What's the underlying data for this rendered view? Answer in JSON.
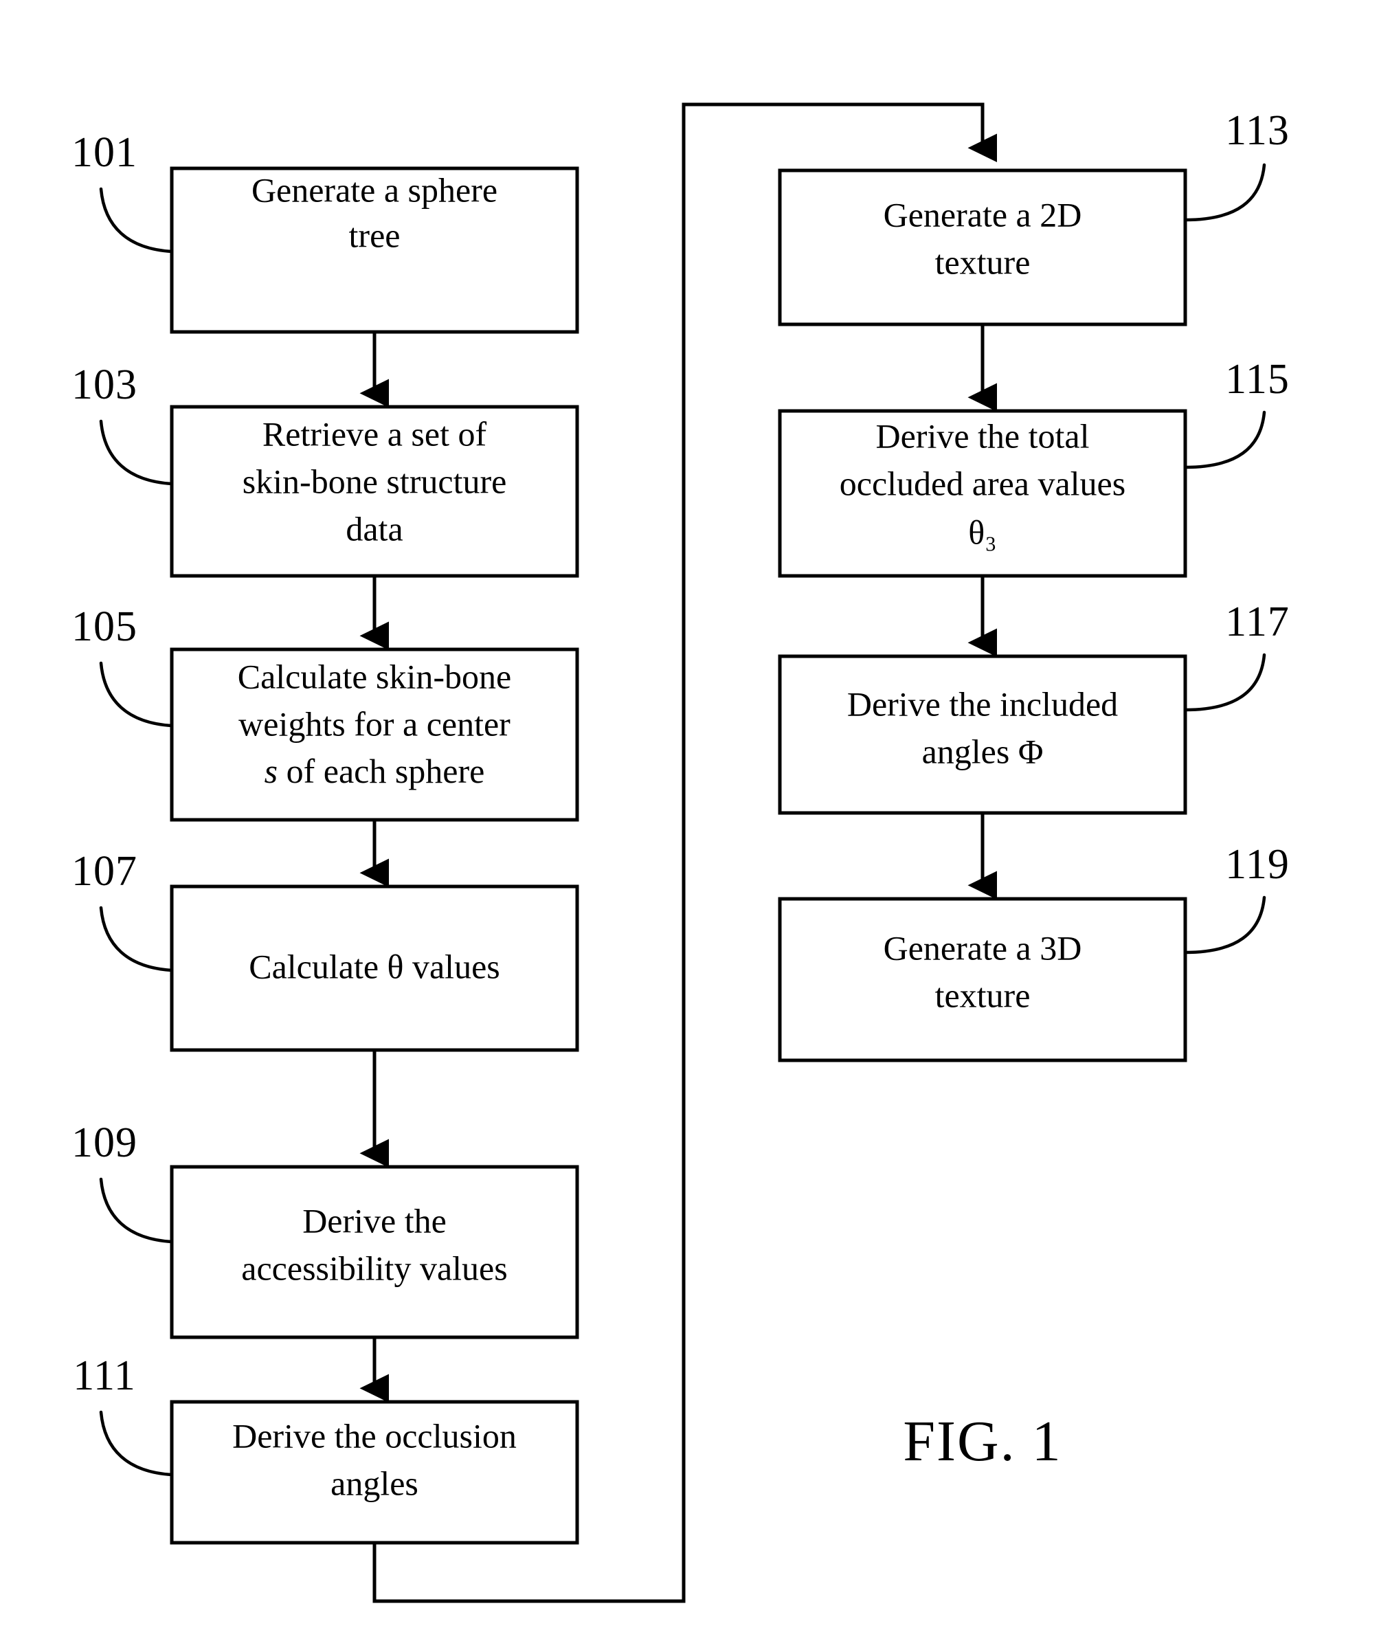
{
  "figure": {
    "caption": "FIG. 1",
    "background_color": "#ffffff",
    "line_color": "#000000"
  },
  "boxes": [
    {
      "ref": "101",
      "lines": [
        "Generate a sphere",
        "tree"
      ],
      "column": "left"
    },
    {
      "ref": "103",
      "lines": [
        "Retrieve a set of",
        "skin-bone structure",
        "data"
      ],
      "column": "left"
    },
    {
      "ref": "105",
      "lines": [
        "Calculate skin-bone",
        "weights for a center",
        "s of each sphere"
      ],
      "italic_token": "s",
      "column": "left"
    },
    {
      "ref": "107",
      "lines": [
        "Calculate θ values"
      ],
      "column": "left"
    },
    {
      "ref": "109",
      "lines": [
        "Derive the",
        "accessibility values"
      ],
      "column": "left"
    },
    {
      "ref": "111",
      "lines": [
        "Derive the occlusion",
        "angles"
      ],
      "column": "left"
    },
    {
      "ref": "113",
      "lines": [
        "Generate a 2D",
        "texture"
      ],
      "column": "right"
    },
    {
      "ref": "115",
      "lines": [
        "Derive the total",
        "occluded area values",
        "θ₃"
      ],
      "subscript_line": "θ₃",
      "column": "right"
    },
    {
      "ref": "117",
      "lines": [
        "Derive the included",
        "angles Φ"
      ],
      "column": "right"
    },
    {
      "ref": "119",
      "lines": [
        "Generate a 3D",
        "texture"
      ],
      "column": "right"
    }
  ],
  "flow": {
    "sequence": [
      "101",
      "103",
      "105",
      "107",
      "109",
      "111",
      "113",
      "115",
      "117",
      "119"
    ],
    "feedback_description": "111 exits bottom, routes left-down, right along bottom, up the left riser and over the top into 113"
  }
}
